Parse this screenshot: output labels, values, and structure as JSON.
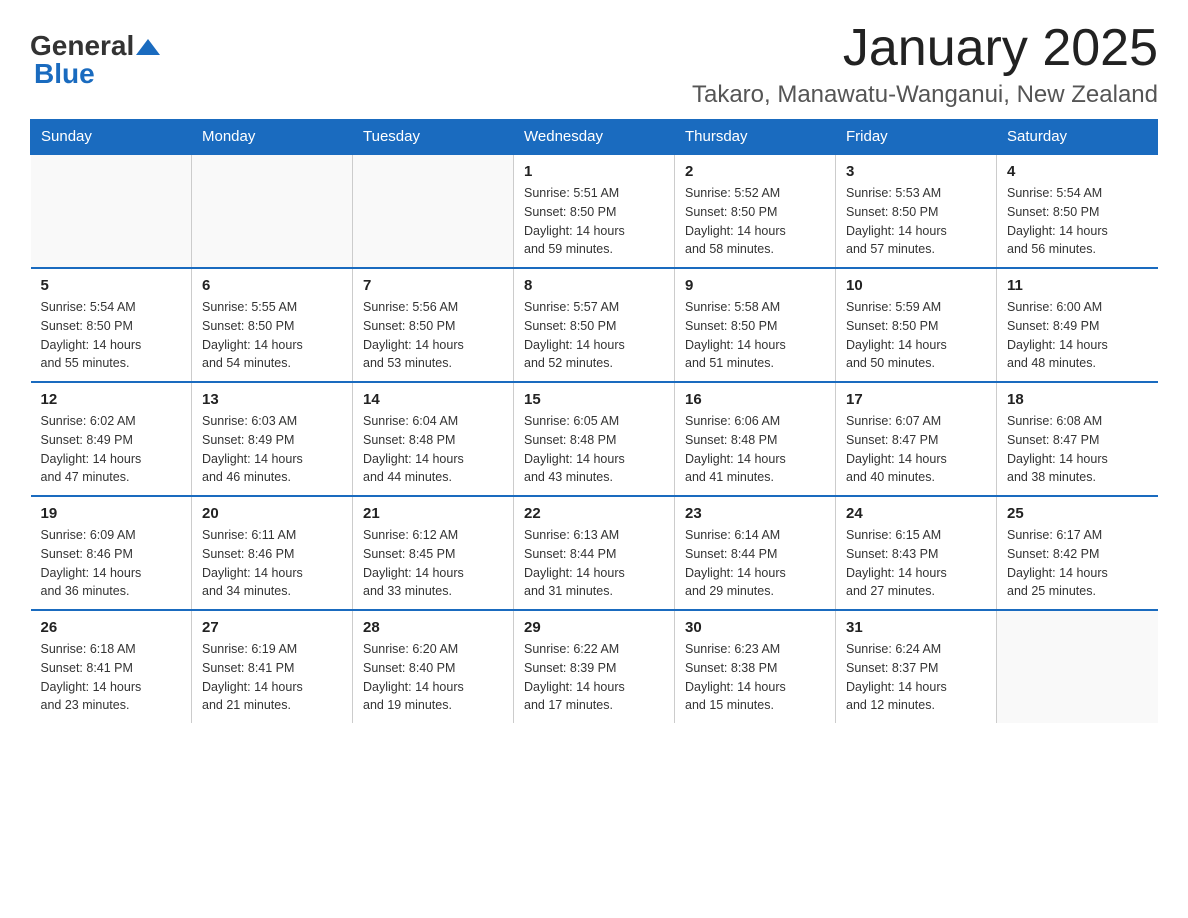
{
  "logo": {
    "general": "General",
    "blue": "Blue"
  },
  "title": "January 2025",
  "location": "Takaro, Manawatu-Wanganui, New Zealand",
  "weekdays": [
    "Sunday",
    "Monday",
    "Tuesday",
    "Wednesday",
    "Thursday",
    "Friday",
    "Saturday"
  ],
  "weeks": [
    [
      {
        "day": "",
        "info": ""
      },
      {
        "day": "",
        "info": ""
      },
      {
        "day": "",
        "info": ""
      },
      {
        "day": "1",
        "info": "Sunrise: 5:51 AM\nSunset: 8:50 PM\nDaylight: 14 hours\nand 59 minutes."
      },
      {
        "day": "2",
        "info": "Sunrise: 5:52 AM\nSunset: 8:50 PM\nDaylight: 14 hours\nand 58 minutes."
      },
      {
        "day": "3",
        "info": "Sunrise: 5:53 AM\nSunset: 8:50 PM\nDaylight: 14 hours\nand 57 minutes."
      },
      {
        "day": "4",
        "info": "Sunrise: 5:54 AM\nSunset: 8:50 PM\nDaylight: 14 hours\nand 56 minutes."
      }
    ],
    [
      {
        "day": "5",
        "info": "Sunrise: 5:54 AM\nSunset: 8:50 PM\nDaylight: 14 hours\nand 55 minutes."
      },
      {
        "day": "6",
        "info": "Sunrise: 5:55 AM\nSunset: 8:50 PM\nDaylight: 14 hours\nand 54 minutes."
      },
      {
        "day": "7",
        "info": "Sunrise: 5:56 AM\nSunset: 8:50 PM\nDaylight: 14 hours\nand 53 minutes."
      },
      {
        "day": "8",
        "info": "Sunrise: 5:57 AM\nSunset: 8:50 PM\nDaylight: 14 hours\nand 52 minutes."
      },
      {
        "day": "9",
        "info": "Sunrise: 5:58 AM\nSunset: 8:50 PM\nDaylight: 14 hours\nand 51 minutes."
      },
      {
        "day": "10",
        "info": "Sunrise: 5:59 AM\nSunset: 8:50 PM\nDaylight: 14 hours\nand 50 minutes."
      },
      {
        "day": "11",
        "info": "Sunrise: 6:00 AM\nSunset: 8:49 PM\nDaylight: 14 hours\nand 48 minutes."
      }
    ],
    [
      {
        "day": "12",
        "info": "Sunrise: 6:02 AM\nSunset: 8:49 PM\nDaylight: 14 hours\nand 47 minutes."
      },
      {
        "day": "13",
        "info": "Sunrise: 6:03 AM\nSunset: 8:49 PM\nDaylight: 14 hours\nand 46 minutes."
      },
      {
        "day": "14",
        "info": "Sunrise: 6:04 AM\nSunset: 8:48 PM\nDaylight: 14 hours\nand 44 minutes."
      },
      {
        "day": "15",
        "info": "Sunrise: 6:05 AM\nSunset: 8:48 PM\nDaylight: 14 hours\nand 43 minutes."
      },
      {
        "day": "16",
        "info": "Sunrise: 6:06 AM\nSunset: 8:48 PM\nDaylight: 14 hours\nand 41 minutes."
      },
      {
        "day": "17",
        "info": "Sunrise: 6:07 AM\nSunset: 8:47 PM\nDaylight: 14 hours\nand 40 minutes."
      },
      {
        "day": "18",
        "info": "Sunrise: 6:08 AM\nSunset: 8:47 PM\nDaylight: 14 hours\nand 38 minutes."
      }
    ],
    [
      {
        "day": "19",
        "info": "Sunrise: 6:09 AM\nSunset: 8:46 PM\nDaylight: 14 hours\nand 36 minutes."
      },
      {
        "day": "20",
        "info": "Sunrise: 6:11 AM\nSunset: 8:46 PM\nDaylight: 14 hours\nand 34 minutes."
      },
      {
        "day": "21",
        "info": "Sunrise: 6:12 AM\nSunset: 8:45 PM\nDaylight: 14 hours\nand 33 minutes."
      },
      {
        "day": "22",
        "info": "Sunrise: 6:13 AM\nSunset: 8:44 PM\nDaylight: 14 hours\nand 31 minutes."
      },
      {
        "day": "23",
        "info": "Sunrise: 6:14 AM\nSunset: 8:44 PM\nDaylight: 14 hours\nand 29 minutes."
      },
      {
        "day": "24",
        "info": "Sunrise: 6:15 AM\nSunset: 8:43 PM\nDaylight: 14 hours\nand 27 minutes."
      },
      {
        "day": "25",
        "info": "Sunrise: 6:17 AM\nSunset: 8:42 PM\nDaylight: 14 hours\nand 25 minutes."
      }
    ],
    [
      {
        "day": "26",
        "info": "Sunrise: 6:18 AM\nSunset: 8:41 PM\nDaylight: 14 hours\nand 23 minutes."
      },
      {
        "day": "27",
        "info": "Sunrise: 6:19 AM\nSunset: 8:41 PM\nDaylight: 14 hours\nand 21 minutes."
      },
      {
        "day": "28",
        "info": "Sunrise: 6:20 AM\nSunset: 8:40 PM\nDaylight: 14 hours\nand 19 minutes."
      },
      {
        "day": "29",
        "info": "Sunrise: 6:22 AM\nSunset: 8:39 PM\nDaylight: 14 hours\nand 17 minutes."
      },
      {
        "day": "30",
        "info": "Sunrise: 6:23 AM\nSunset: 8:38 PM\nDaylight: 14 hours\nand 15 minutes."
      },
      {
        "day": "31",
        "info": "Sunrise: 6:24 AM\nSunset: 8:37 PM\nDaylight: 14 hours\nand 12 minutes."
      },
      {
        "day": "",
        "info": ""
      }
    ]
  ]
}
